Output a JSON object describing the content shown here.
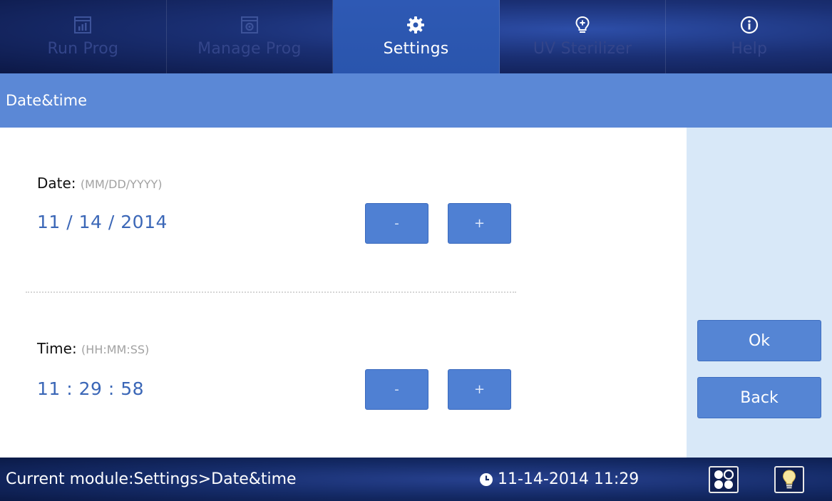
{
  "nav": {
    "tabs": [
      {
        "label": "Run Prog",
        "icon": "chart-window-icon"
      },
      {
        "label": "Manage Prog",
        "icon": "gear-window-icon"
      },
      {
        "label": "Settings",
        "icon": "gear-icon"
      },
      {
        "label": "UV Sterilizer",
        "icon": "lightbulb-plus-icon"
      },
      {
        "label": "Help",
        "icon": "info-icon"
      }
    ],
    "active_index": 2
  },
  "header": {
    "title": "Date&time"
  },
  "date": {
    "label": "Date:",
    "format_hint": "(MM/DD/YYYY)",
    "value": "11 / 14 / 2014",
    "minus_label": "-",
    "plus_label": "+"
  },
  "time": {
    "label": "Time:",
    "format_hint": "(HH:MM:SS)",
    "value": "11 : 29 : 58",
    "minus_label": "-",
    "plus_label": "+"
  },
  "actions": {
    "ok_label": "Ok",
    "back_label": "Back"
  },
  "status": {
    "module_text": "Current module:Settings>Date&time",
    "clock_icon": "clock-icon",
    "datetime": "11-14-2014 11:29",
    "right_icons": [
      "app-grid-icon",
      "lightbulb-icon"
    ]
  },
  "colors": {
    "accent": "#5b88d6",
    "button": "#4f80d3",
    "value_text": "#3b67b7",
    "side_panel": "#d8e8f8",
    "nav_background": "#1a2f73"
  }
}
